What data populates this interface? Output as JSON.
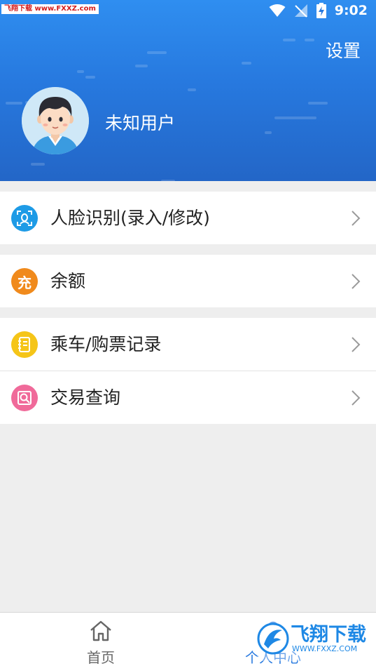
{
  "status_bar": {
    "watermark": "飞翔下载 www.FXXZ.com",
    "time": "9:02"
  },
  "header": {
    "settings_label": "设置",
    "username": "未知用户"
  },
  "menu": [
    {
      "label": "人脸识别(录入/修改)",
      "icon": "face-scan-icon",
      "color": "#1e9be6"
    },
    {
      "label": "余额",
      "icon": "balance-icon",
      "icon_text": "充",
      "color": "#f08a1c"
    },
    {
      "label": "乘车/购票记录",
      "icon": "notebook-icon",
      "color": "#f5c518"
    },
    {
      "label": "交易查询",
      "icon": "search-document-icon",
      "color": "#f06a9a"
    }
  ],
  "bottom_nav": {
    "tabs": [
      {
        "label": "首页",
        "icon": "home-icon",
        "active": false
      },
      {
        "label": "个人中心",
        "icon": "user-center-icon",
        "active": true
      }
    ]
  },
  "logo_watermark": {
    "text": "飞翔下载",
    "url": "WWW.FXXZ.COM"
  },
  "colors": {
    "header_blue": "#2779df",
    "active_tab": "#2779df",
    "inactive_tab": "#666666"
  }
}
